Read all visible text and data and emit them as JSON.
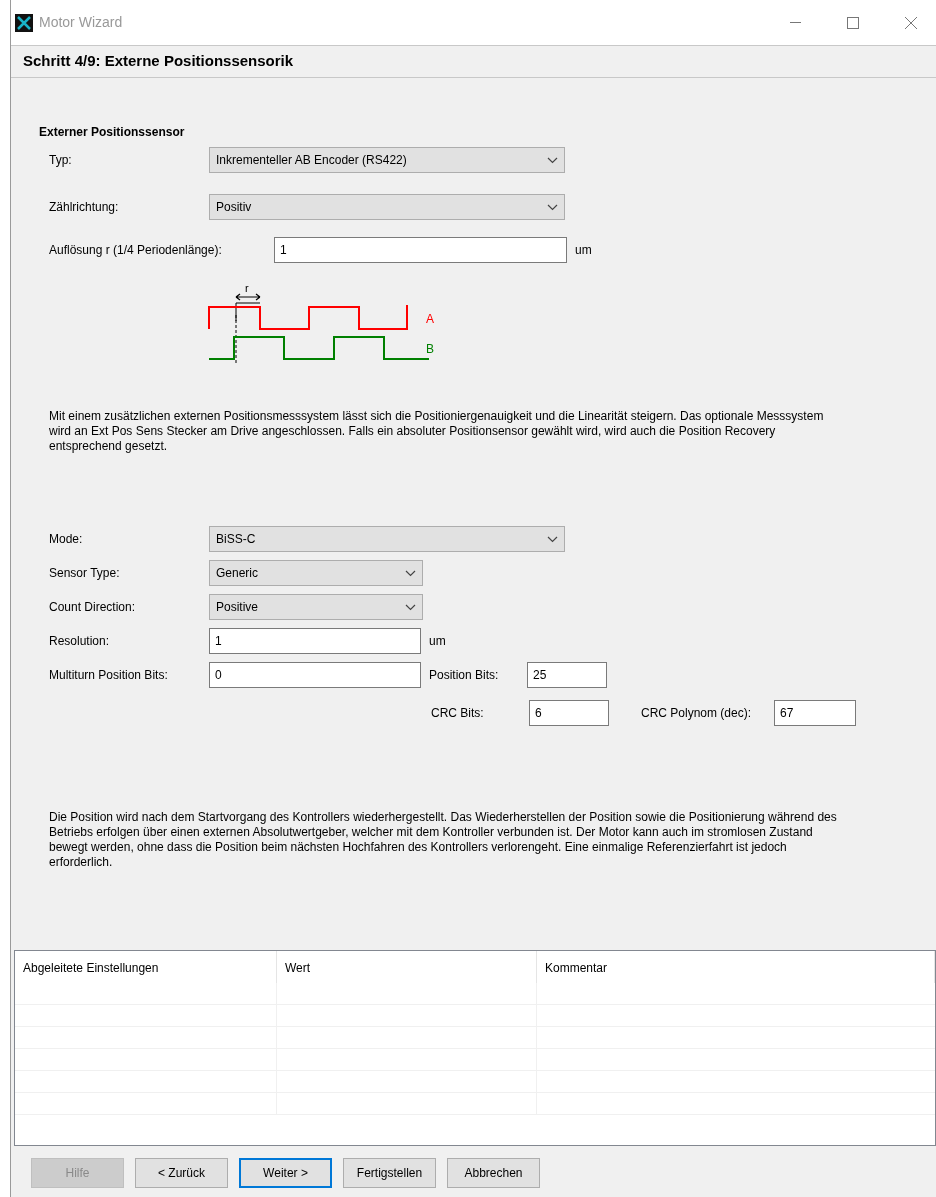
{
  "window": {
    "title": "Motor Wizard"
  },
  "step_title": "Schritt 4/9: Externe Positionssensorik",
  "section_title": "Externer Positionssensor",
  "sensor_fields": [
    {
      "kind": "dropdown",
      "label": "Typ:",
      "value": "Inkrementeller AB Encoder (RS422)"
    },
    {
      "kind": "dropdown",
      "label": "Zählrichtung:",
      "value": "Positiv"
    },
    {
      "kind": "input",
      "label": "Auflösung r (1/4 Periodenlänge):",
      "value": "1",
      "unit": "um"
    }
  ],
  "diagram": {
    "dimension_label": "r",
    "channels": [
      {
        "name": "A",
        "color": "#ff0000"
      },
      {
        "name": "B",
        "color": "#008000"
      }
    ]
  },
  "description": "Mit einem zusätzlichen externen Positionsmesssystem lässt sich die Positioniergenauigkeit und die Linearität steigern. Das optionale Messsystem wird an Ext Pos Sens Stecker am Drive angeschlossen. Falls ein absoluter Positionsensor gewählt wird, wird auch die Position Recovery entsprechend gesetzt.",
  "mode_fields": [
    {
      "kind": "dropdown",
      "label": "Mode:",
      "value": "BiSS-C",
      "wide": true
    },
    {
      "kind": "dropdown",
      "label": "Sensor Type:",
      "value": "Generic",
      "wide": false
    },
    {
      "kind": "dropdown",
      "label": "Count Direction:",
      "value": "Positive",
      "wide": false
    },
    {
      "kind": "input",
      "label": "Resolution:",
      "value": "1",
      "unit": "um"
    },
    {
      "kind": "input",
      "label": "Multiturn Position Bits:",
      "value": "0"
    }
  ],
  "bit_fields": [
    {
      "label": "Position Bits:",
      "value": "25"
    },
    {
      "label": "CRC Bits:",
      "value": "6"
    },
    {
      "label": "CRC Polynom (dec):",
      "value": "67"
    }
  ],
  "description_2": "Die Position wird nach dem Startvorgang des Kontrollers wiederhergestellt. Das Wiederherstellen der Position sowie die Positionierung während des Betriebs erfolgen über einen externen Absolutwertgeber, welcher mit dem Kontroller verbunden ist. Der Motor kann auch im stromlosen Zustand bewegt werden, ohne dass die Position beim nächsten Hochfahren des Kontrollers verlorengeht. Eine einmalige Referenzierfahrt ist jedoch erforderlich.",
  "table": {
    "columns": [
      "Abgeleitete Einstellungen",
      "Wert",
      "Kommentar"
    ]
  },
  "buttons": [
    {
      "label": "Hilfe",
      "disabled": true,
      "default": false
    },
    {
      "label": "< Zurück",
      "disabled": false,
      "default": false
    },
    {
      "label": "Weiter >",
      "disabled": false,
      "default": true
    },
    {
      "label": "Fertigstellen",
      "disabled": false,
      "default": false
    },
    {
      "label": "Abbrechen",
      "disabled": false,
      "default": false
    }
  ]
}
